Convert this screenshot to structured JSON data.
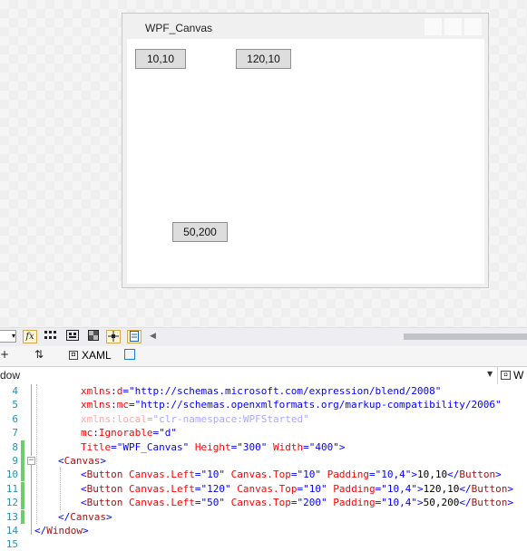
{
  "designer": {
    "window_title": "WPF_Canvas",
    "buttons": [
      {
        "label": "10,10"
      },
      {
        "label": "120,10"
      },
      {
        "label": "50,200"
      }
    ]
  },
  "toolbar": {
    "icons": [
      "combo-dropdown",
      "fx-icon",
      "grid-icon",
      "snap-grid-icon",
      "artboard-background-icon",
      "snap-lines-icon",
      "annotations-icon",
      "scroll-left-icon"
    ],
    "fx_label": "fx"
  },
  "tabs": {
    "left_symbol": "+",
    "swap_symbol": "⇅",
    "xaml_label": "XAML",
    "xaml_icon_glyph": "◘"
  },
  "navbar": {
    "left_text": "dow",
    "right_text": "W",
    "dropdown_glyph": "▼"
  },
  "editor": {
    "lines": [
      {
        "num": "4",
        "parts": [
          {
            "t": "xmlns",
            "c": "t-attr"
          },
          {
            "t": ":",
            "c": "t-blue"
          },
          {
            "t": "d",
            "c": "t-attr"
          },
          {
            "t": "=",
            "c": "t-blue"
          },
          {
            "t": "\"http://schemas.microsoft.com/expression/blend/2008\"",
            "c": "t-val"
          }
        ]
      },
      {
        "num": "5",
        "parts": [
          {
            "t": "xmlns",
            "c": "t-attr"
          },
          {
            "t": ":",
            "c": "t-blue"
          },
          {
            "t": "mc",
            "c": "t-attr"
          },
          {
            "t": "=",
            "c": "t-blue"
          },
          {
            "t": "\"http://schemas.openxmlformats.org/markup-compatibility/2006\"",
            "c": "t-val"
          }
        ]
      },
      {
        "num": "6",
        "parts": [
          {
            "t": "xmlns",
            "c": "t-dim-attr"
          },
          {
            "t": ":",
            "c": "t-dim-val"
          },
          {
            "t": "local",
            "c": "t-dim-attr"
          },
          {
            "t": "=",
            "c": "t-dim-val"
          },
          {
            "t": "\"clr-namespace:WPFStarted\"",
            "c": "t-dim-val"
          }
        ]
      },
      {
        "num": "7",
        "parts": [
          {
            "t": "mc",
            "c": "t-attr"
          },
          {
            "t": ":",
            "c": "t-blue"
          },
          {
            "t": "Ignorable",
            "c": "t-attr"
          },
          {
            "t": "=",
            "c": "t-blue"
          },
          {
            "t": "\"d\"",
            "c": "t-val"
          }
        ]
      },
      {
        "num": "8",
        "parts": [
          {
            "t": "Title",
            "c": "t-attr"
          },
          {
            "t": "=",
            "c": "t-blue"
          },
          {
            "t": "\"WPF_Canvas\"",
            "c": "t-val"
          },
          {
            "t": " Height",
            "c": "t-attr"
          },
          {
            "t": "=",
            "c": "t-blue"
          },
          {
            "t": "\"300\"",
            "c": "t-val"
          },
          {
            "t": " Width",
            "c": "t-attr"
          },
          {
            "t": "=",
            "c": "t-blue"
          },
          {
            "t": "\"400\"",
            "c": "t-val"
          },
          {
            "t": ">",
            "c": "t-blue"
          }
        ]
      },
      {
        "num": "9",
        "parts": [
          {
            "t": "<",
            "c": "t-blue"
          },
          {
            "t": "Canvas",
            "c": "t-tag"
          },
          {
            "t": ">",
            "c": "t-blue"
          }
        ]
      },
      {
        "num": "10",
        "parts": [
          {
            "t": "<",
            "c": "t-blue"
          },
          {
            "t": "Button",
            "c": "t-tag"
          },
          {
            "t": " Canvas.Left",
            "c": "t-attr"
          },
          {
            "t": "=",
            "c": "t-blue"
          },
          {
            "t": "\"10\"",
            "c": "t-val"
          },
          {
            "t": " Canvas.Top",
            "c": "t-attr"
          },
          {
            "t": "=",
            "c": "t-blue"
          },
          {
            "t": "\"10\"",
            "c": "t-val"
          },
          {
            "t": " Padding",
            "c": "t-attr"
          },
          {
            "t": "=",
            "c": "t-blue"
          },
          {
            "t": "\"10,4\"",
            "c": "t-val"
          },
          {
            "t": ">",
            "c": "t-blue"
          },
          {
            "t": "10,10",
            "c": "t-text"
          },
          {
            "t": "</",
            "c": "t-blue"
          },
          {
            "t": "Button",
            "c": "t-tag"
          },
          {
            "t": ">",
            "c": "t-blue"
          }
        ]
      },
      {
        "num": "11",
        "parts": [
          {
            "t": "<",
            "c": "t-blue"
          },
          {
            "t": "Button",
            "c": "t-tag"
          },
          {
            "t": " Canvas.Left",
            "c": "t-attr"
          },
          {
            "t": "=",
            "c": "t-blue"
          },
          {
            "t": "\"120\"",
            "c": "t-val"
          },
          {
            "t": " Canvas.Top",
            "c": "t-attr"
          },
          {
            "t": "=",
            "c": "t-blue"
          },
          {
            "t": "\"10\"",
            "c": "t-val"
          },
          {
            "t": " Padding",
            "c": "t-attr"
          },
          {
            "t": "=",
            "c": "t-blue"
          },
          {
            "t": "\"10,4\"",
            "c": "t-val"
          },
          {
            "t": ">",
            "c": "t-blue"
          },
          {
            "t": "120,10",
            "c": "t-text"
          },
          {
            "t": "</",
            "c": "t-blue"
          },
          {
            "t": "Button",
            "c": "t-tag"
          },
          {
            "t": ">",
            "c": "t-blue"
          }
        ]
      },
      {
        "num": "12",
        "parts": [
          {
            "t": "<",
            "c": "t-blue"
          },
          {
            "t": "Button",
            "c": "t-tag"
          },
          {
            "t": " Canvas.Left",
            "c": "t-attr"
          },
          {
            "t": "=",
            "c": "t-blue"
          },
          {
            "t": "\"50\"",
            "c": "t-val"
          },
          {
            "t": " Canvas.Top",
            "c": "t-attr"
          },
          {
            "t": "=",
            "c": "t-blue"
          },
          {
            "t": "\"200\"",
            "c": "t-val"
          },
          {
            "t": " Padding",
            "c": "t-attr"
          },
          {
            "t": "=",
            "c": "t-blue"
          },
          {
            "t": "\"10,4\"",
            "c": "t-val"
          },
          {
            "t": ">",
            "c": "t-blue"
          },
          {
            "t": "50,200",
            "c": "t-text"
          },
          {
            "t": "</",
            "c": "t-blue"
          },
          {
            "t": "Button",
            "c": "t-tag"
          },
          {
            "t": ">",
            "c": "t-blue"
          }
        ]
      },
      {
        "num": "13",
        "parts": [
          {
            "t": "</",
            "c": "t-blue"
          },
          {
            "t": "Canvas",
            "c": "t-tag"
          },
          {
            "t": ">",
            "c": "t-blue"
          }
        ]
      },
      {
        "num": "14",
        "parts": [
          {
            "t": "</",
            "c": "t-blue"
          },
          {
            "t": "Window",
            "c": "t-tag"
          },
          {
            "t": ">",
            "c": "t-blue"
          }
        ]
      },
      {
        "num": "15",
        "parts": []
      }
    ]
  }
}
